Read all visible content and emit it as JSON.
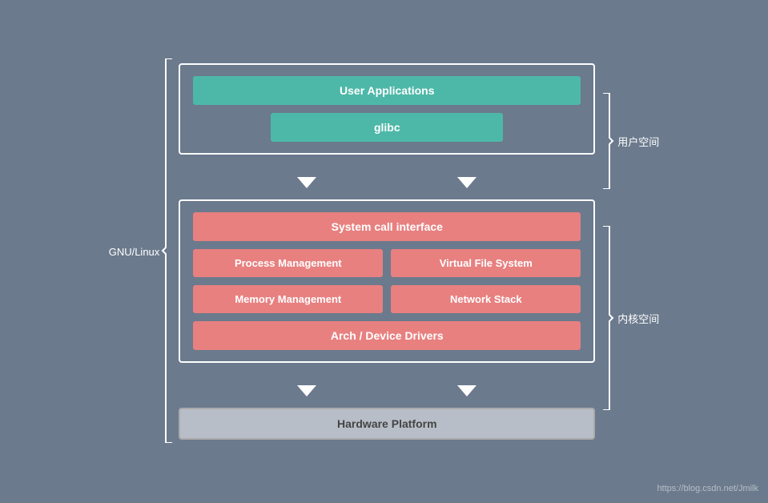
{
  "diagram": {
    "background_color": "#6b7a8d",
    "label_gnu": "GNU/Linux",
    "label_user_space": "用户空间",
    "label_kernel_space": "内核空间",
    "user_space": {
      "blocks": [
        {
          "id": "user-applications",
          "label": "User Applications"
        },
        {
          "id": "glibc",
          "label": "glibc"
        }
      ]
    },
    "kernel_space": {
      "blocks": [
        {
          "id": "syscall",
          "label": "System call interface"
        },
        {
          "id": "process-mgmt",
          "label": "Process Management"
        },
        {
          "id": "virtual-fs",
          "label": "Virtual File System"
        },
        {
          "id": "memory-mgmt",
          "label": "Memory Management"
        },
        {
          "id": "network-stack",
          "label": "Network Stack"
        },
        {
          "id": "arch-drivers",
          "label": "Arch / Device Drivers"
        }
      ]
    },
    "hardware": {
      "id": "hardware-platform",
      "label": "Hardware Platform"
    }
  },
  "watermark": "https://blog.csdn.net/Jmilk"
}
